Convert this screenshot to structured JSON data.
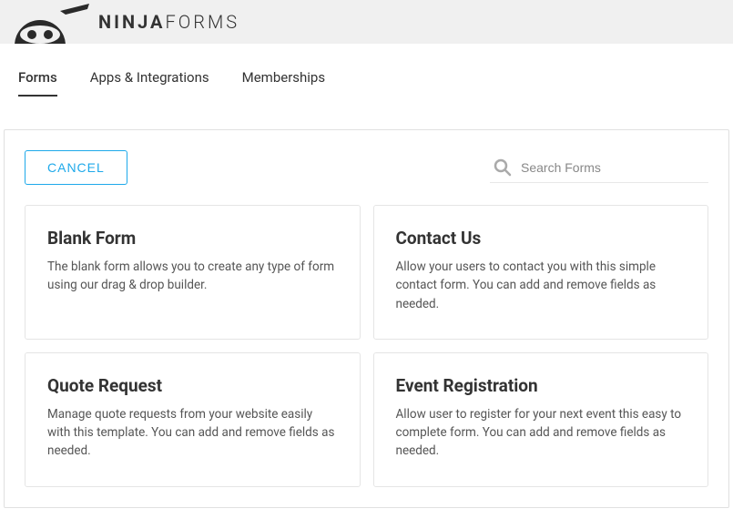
{
  "brand": {
    "bold": "NINJA",
    "light": "FORMS"
  },
  "tabs": [
    {
      "label": "Forms",
      "active": true
    },
    {
      "label": "Apps & Integrations",
      "active": false
    },
    {
      "label": "Memberships",
      "active": false
    }
  ],
  "actions": {
    "cancel": "CANCEL"
  },
  "search": {
    "placeholder": "Search Forms"
  },
  "templates": [
    {
      "title": "Blank Form",
      "desc": "The blank form allows you to create any type of form using our drag & drop builder."
    },
    {
      "title": "Contact Us",
      "desc": "Allow your users to contact you with this simple contact form. You can add and remove fields as needed."
    },
    {
      "title": "Quote Request",
      "desc": "Manage quote requests from your website easily with this template. You can add and remove fields as needed."
    },
    {
      "title": "Event Registration",
      "desc": "Allow user to register for your next event this easy to complete form. You can add and remove fields as needed."
    }
  ]
}
